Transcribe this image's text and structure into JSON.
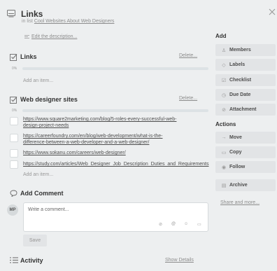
{
  "card": {
    "title": "Links",
    "in_list_prefix": "in list",
    "list_name": "Cool Websites About Web Designers",
    "edit_description": "Edit the description..."
  },
  "checklists": [
    {
      "title": "Links",
      "delete": "Delete...",
      "percent": "0%",
      "progress": 0,
      "add_item": "Add an item..."
    },
    {
      "title": "Web designer sites",
      "delete": "Delete...",
      "percent": "0%",
      "progress": 0,
      "items": [
        {
          "line1": "https://www.square2marketing.com/blog/5-roles-every-successful-web-",
          "line2": "design-project-needs"
        },
        {
          "line1": "https://careerfoundry.com/en/blog/web-development/what-is-the-",
          "line2": "difference-between-a-web-developer-and-a-web-designer/"
        },
        {
          "line1": "https://www.sokanu.com/careers/web-designer/",
          "line2": ""
        },
        {
          "line1": "https://study.com/articles/Web_Designer_Job_Description_Duties_and_Requirements",
          "line2": ""
        }
      ],
      "add_item": "Add an item..."
    }
  ],
  "comment": {
    "title": "Add Comment",
    "avatar": "MP",
    "placeholder": "Write a comment...",
    "save": "Save"
  },
  "activity": {
    "title": "Activity",
    "show_details": "Show Details"
  },
  "sidebar": {
    "add_heading": "Add",
    "add_buttons": [
      {
        "icon": "person-icon",
        "glyph": "♙",
        "label": "Members"
      },
      {
        "icon": "tag-icon",
        "glyph": "◇",
        "label": "Labels"
      },
      {
        "icon": "checklist-icon",
        "glyph": "☑",
        "label": "Checklist"
      },
      {
        "icon": "clock-icon",
        "glyph": "◷",
        "label": "Due Date"
      },
      {
        "icon": "paperclip-icon",
        "glyph": "⊘",
        "label": "Attachment"
      }
    ],
    "actions_heading": "Actions",
    "action_buttons": [
      {
        "icon": "arrow-right-icon",
        "glyph": "→",
        "label": "Move"
      },
      {
        "icon": "copy-icon",
        "glyph": "▭",
        "label": "Copy"
      },
      {
        "icon": "eye-icon",
        "glyph": "◉",
        "label": "Follow"
      },
      {
        "icon": "archive-icon",
        "glyph": "▤",
        "label": "Archive"
      }
    ],
    "share": "Share and more..."
  },
  "colors": {
    "background": "#edeff0",
    "sidebar_button": "#e2e4e6",
    "progress_track": "#dde2e5"
  }
}
